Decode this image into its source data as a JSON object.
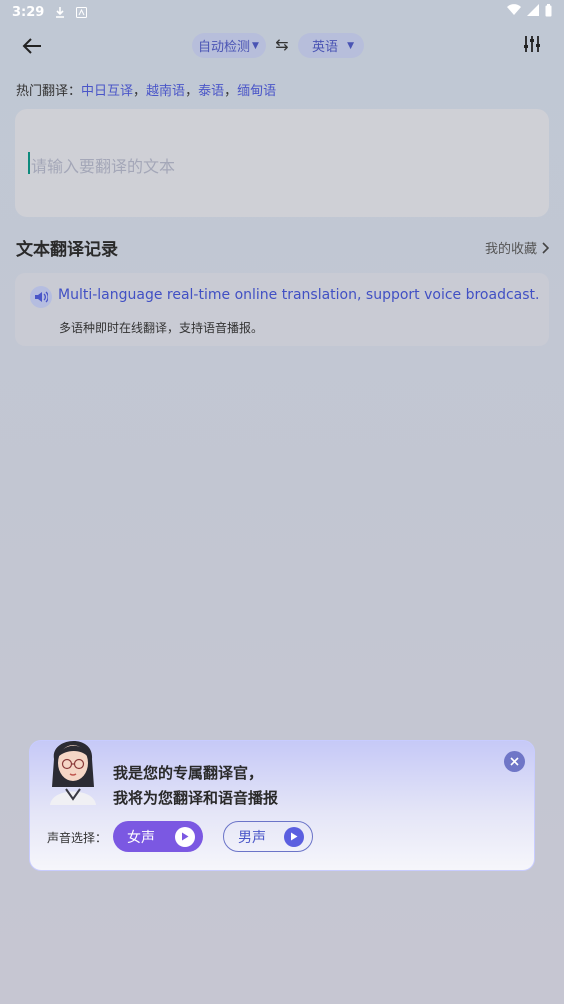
{
  "status_bar": {
    "time": "3:29"
  },
  "header": {
    "source_language": "自动检测",
    "target_language": "英语"
  },
  "hot_translations": {
    "label": "热门翻译：",
    "items": [
      "中日互译",
      "越南语",
      "泰语",
      "缅甸语"
    ],
    "separator": "，"
  },
  "input": {
    "placeholder": "请输入要翻译的文本"
  },
  "history": {
    "title": "文本翻译记录",
    "favorites_label": "我的收藏",
    "items": [
      {
        "source": "Multi-language real-time online translation, support voice broadcast.",
        "translation": "多语种即时在线翻译，支持语音播报。"
      }
    ]
  },
  "voice_popup": {
    "line1": "我是您的专属翻译官，",
    "line2": "我将为您翻译和语音播报",
    "voice_label": "声音选择：",
    "female_label": "女声",
    "male_label": "男声"
  },
  "colors": {
    "accent": "#4a56c8",
    "female_button": "#7b58e2",
    "caret": "#0e8a7d"
  }
}
